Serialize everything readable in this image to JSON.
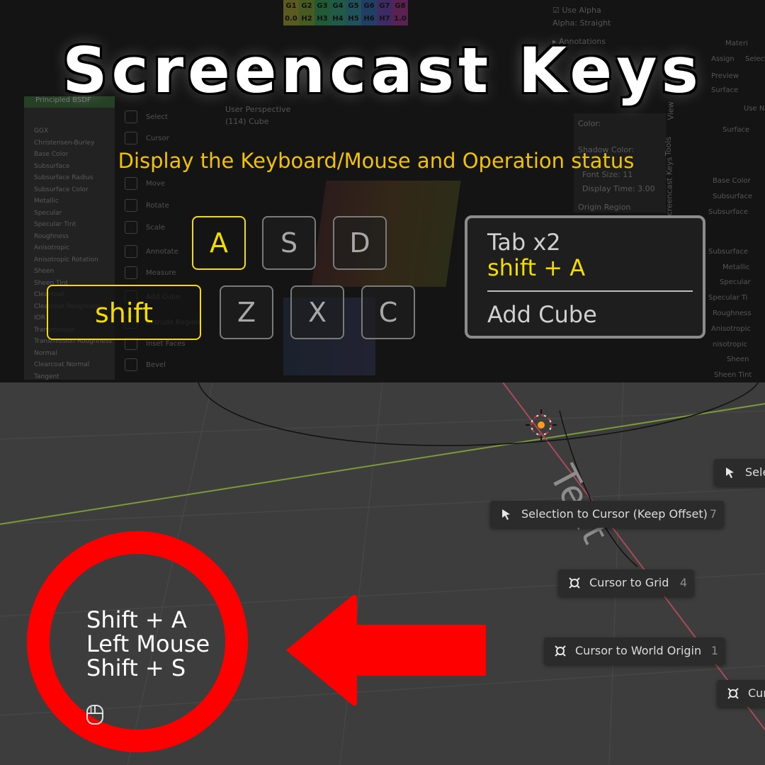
{
  "header": {
    "title": "Screencast Keys",
    "subtitle": "Display the Keyboard/Mouse and Operation status"
  },
  "keys": {
    "row1": [
      "A",
      "S",
      "D"
    ],
    "row2": [
      "Z",
      "X",
      "C"
    ],
    "shift": "shift",
    "active": [
      "A",
      "shift"
    ]
  },
  "status_box": {
    "line1": "Tab x2",
    "line2": "shift + A",
    "line3": "Add Cube"
  },
  "background_ui": {
    "color_grid_row1": [
      "G1",
      "G2",
      "G3",
      "G4",
      "G5",
      "G6",
      "G7",
      "G8"
    ],
    "color_grid_row2": [
      "0.0",
      "H2",
      "H3",
      "H4",
      "H5",
      "H6",
      "H7",
      "1.0"
    ],
    "viewport_info": [
      "User Perspective",
      "(114) Cube"
    ],
    "tools": [
      "Select",
      "Cursor",
      "Move",
      "Rotate",
      "Scale",
      "Annotate",
      "Measure",
      "Add Cube",
      "Extrude Region",
      "Inset Faces",
      "Bevel"
    ],
    "node_panel_title": "Principled BSDF",
    "node_rows": [
      "GGX",
      "Christensen-Burley",
      "Base Color",
      "Subsurface",
      "Subsurface Radius",
      "Subsurface Color",
      "Metallic",
      "Specular",
      "Specular Tint",
      "Roughness",
      "Anisotropic",
      "Anisotropic Rotation",
      "Sheen",
      "Sheen Tint",
      "Clearcoat",
      "Clearcoat Roughness",
      "IOR",
      "Transmission",
      "Transmission Roughness",
      "Normal",
      "Clearcoat Normal",
      "Tangent"
    ],
    "props_top": [
      "Use Alpha",
      "Alpha:",
      "Straight",
      "Annotations"
    ],
    "props_mid": [
      "Color:",
      "Shadow Color:",
      "Font Size:",
      "11",
      "Display Time:",
      "3.00",
      "Origin",
      "Region"
    ],
    "right_panel": [
      "Materi",
      "Assign",
      "Select",
      "Preview",
      "Surface",
      "Use N",
      "Surface",
      "Base Color",
      "Subsurface",
      "Subsurface",
      "Subsurface",
      "Metallic",
      "Specular",
      "Specular Ti",
      "Roughness",
      "Anisotropic",
      "nisotropic",
      "Sheen",
      "Sheen Tint"
    ],
    "side_tabs": [
      "View",
      "Tools",
      "Screencast Keys"
    ]
  },
  "viewport": {
    "text_object": "Text"
  },
  "snap_menu": [
    {
      "label": "Sele",
      "shortcut": "",
      "icon": "cursor-arrow-icon"
    },
    {
      "label": "Selection to Cursor (Keep Offset)",
      "shortcut": "7",
      "icon": "cursor-arrow-icon"
    },
    {
      "label": "Cursor to Grid",
      "shortcut": "4",
      "icon": "3d-cursor-icon"
    },
    {
      "label": "Cursor to World Origin",
      "shortcut": "1",
      "icon": "3d-cursor-icon"
    },
    {
      "label": "Cur",
      "shortcut": "",
      "icon": "3d-cursor-icon"
    }
  ],
  "overlay_status": [
    "Shift + A",
    "Left Mouse",
    "Shift + S"
  ],
  "colors": {
    "accent_yellow": "#f5dc00",
    "highlight_red": "#ff0000",
    "viewport_bg": "#3d3d3d"
  }
}
